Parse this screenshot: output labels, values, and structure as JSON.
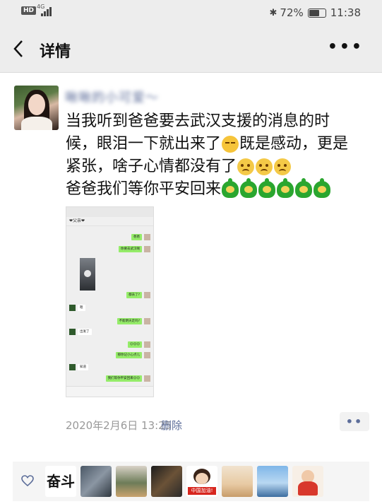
{
  "status_bar": {
    "badge": "HD",
    "network": "4G",
    "battery": "72%",
    "battery_level": 0.72,
    "time": "11:38"
  },
  "nav": {
    "back_icon": "chevron-left-icon",
    "title": "详情",
    "more_icon": "more-icon"
  },
  "post": {
    "username": "啾啾的小可爱～",
    "lines": [
      "当我听到爸爸要去武汉支援的消息的时",
      "候，眼泪一下就出来了",
      "既是感动，更是",
      "紧张，啥子心情都没有了",
      "爸爸我们等你平安回来"
    ],
    "timestamp": "2020年2月6日 13:25",
    "delete_label": "删除",
    "more_label": "••"
  },
  "screenshot": {
    "title": "❤父亲❤",
    "messages": [
      {
        "side": "right",
        "text": "爸爸"
      },
      {
        "side": "right",
        "text": "你要去武汉啊"
      },
      {
        "side": "right",
        "text": "都去了?"
      },
      {
        "side": "left",
        "text": "嗯"
      },
      {
        "side": "right",
        "text": "不能明天走吗?"
      },
      {
        "side": "left",
        "text": "出发了"
      },
      {
        "side": "right",
        "text": "😔😔😔"
      },
      {
        "side": "right",
        "text": "那你记小心点儿"
      },
      {
        "side": "left",
        "text": "知道"
      },
      {
        "side": "right",
        "text": "我们等你平安回来😔😔"
      }
    ]
  },
  "likes": {
    "heart_icon": "heart-outline-icon",
    "avatars": [
      "奋斗",
      "avatar-2",
      "avatar-3",
      "avatar-4",
      "中国加油!",
      "avatar-6",
      "avatar-7",
      "avatar-8"
    ]
  },
  "colors": {
    "link": "#5d6e9a",
    "bubble_green": "#95ec69",
    "bar_gray": "#ededed"
  }
}
